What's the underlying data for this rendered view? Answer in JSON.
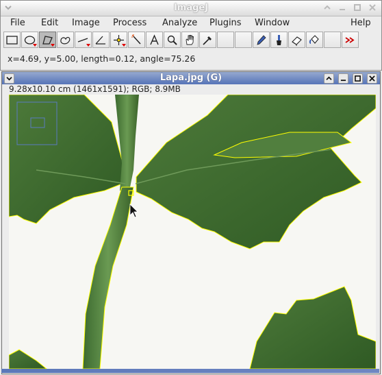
{
  "app": {
    "title": "ImageJ",
    "menus": [
      "File",
      "Edit",
      "Image",
      "Process",
      "Analyze",
      "Plugins",
      "Window",
      "Help"
    ],
    "tools": [
      {
        "name": "rectangle-tool",
        "selected": false,
        "has_options": false
      },
      {
        "name": "oval-tool",
        "selected": false,
        "has_options": true
      },
      {
        "name": "polygon-tool",
        "selected": true,
        "has_options": true
      },
      {
        "name": "freehand-tool",
        "selected": false,
        "has_options": false
      },
      {
        "name": "line-tool",
        "selected": false,
        "has_options": true
      },
      {
        "name": "angle-tool",
        "selected": false,
        "has_options": false
      },
      {
        "name": "point-tool",
        "selected": false,
        "has_options": true
      },
      {
        "name": "wand-tool",
        "selected": false,
        "has_options": false
      },
      {
        "name": "text-tool",
        "selected": false,
        "has_options": false
      },
      {
        "name": "magnifier-tool",
        "selected": false,
        "has_options": false
      },
      {
        "name": "hand-tool",
        "selected": false,
        "has_options": false
      },
      {
        "name": "dropper-tool",
        "selected": false,
        "has_options": false
      },
      {
        "name": "blank-slot",
        "selected": false,
        "has_options": false
      },
      {
        "name": "blank-slot",
        "selected": false,
        "has_options": false
      },
      {
        "name": "pencil-tool",
        "selected": false,
        "has_options": false
      },
      {
        "name": "brush-tool",
        "selected": false,
        "has_options": false
      },
      {
        "name": "eraser-tool",
        "selected": false,
        "has_options": false
      },
      {
        "name": "flood-fill-tool",
        "selected": false,
        "has_options": false
      },
      {
        "name": "blank-slot",
        "selected": false,
        "has_options": false
      },
      {
        "name": "more-tools-menu",
        "selected": false,
        "has_options": false
      }
    ],
    "status": "x=4.69, y=5.00, length=0.12, angle=75.26"
  },
  "image_window": {
    "title": "Lapa.jpg (G)",
    "info": "9.28x10.10 cm (1461x1591); RGB; 8.9MB"
  },
  "colors": {
    "selection": "#ffff00",
    "leaf": "#3d6b2e",
    "title_active": "#5674b8",
    "navigator": "#5a7bc0"
  }
}
